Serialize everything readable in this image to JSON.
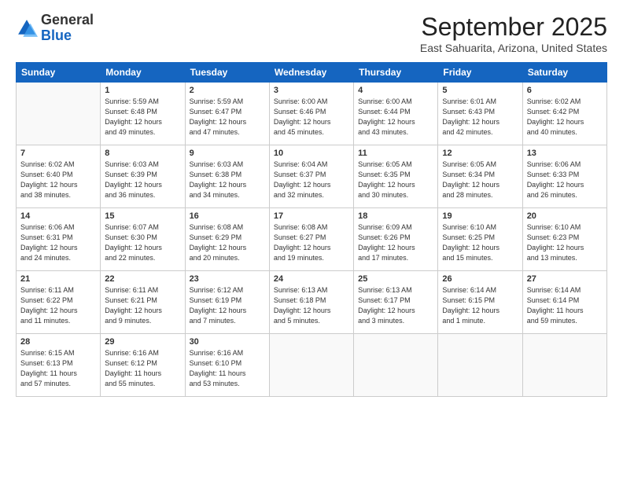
{
  "logo": {
    "general": "General",
    "blue": "Blue"
  },
  "title": "September 2025",
  "location": "East Sahuarita, Arizona, United States",
  "days_of_week": [
    "Sunday",
    "Monday",
    "Tuesday",
    "Wednesday",
    "Thursday",
    "Friday",
    "Saturday"
  ],
  "weeks": [
    [
      {
        "day": "",
        "info": ""
      },
      {
        "day": "1",
        "info": "Sunrise: 5:59 AM\nSunset: 6:48 PM\nDaylight: 12 hours\nand 49 minutes."
      },
      {
        "day": "2",
        "info": "Sunrise: 5:59 AM\nSunset: 6:47 PM\nDaylight: 12 hours\nand 47 minutes."
      },
      {
        "day": "3",
        "info": "Sunrise: 6:00 AM\nSunset: 6:46 PM\nDaylight: 12 hours\nand 45 minutes."
      },
      {
        "day": "4",
        "info": "Sunrise: 6:00 AM\nSunset: 6:44 PM\nDaylight: 12 hours\nand 43 minutes."
      },
      {
        "day": "5",
        "info": "Sunrise: 6:01 AM\nSunset: 6:43 PM\nDaylight: 12 hours\nand 42 minutes."
      },
      {
        "day": "6",
        "info": "Sunrise: 6:02 AM\nSunset: 6:42 PM\nDaylight: 12 hours\nand 40 minutes."
      }
    ],
    [
      {
        "day": "7",
        "info": "Sunrise: 6:02 AM\nSunset: 6:40 PM\nDaylight: 12 hours\nand 38 minutes."
      },
      {
        "day": "8",
        "info": "Sunrise: 6:03 AM\nSunset: 6:39 PM\nDaylight: 12 hours\nand 36 minutes."
      },
      {
        "day": "9",
        "info": "Sunrise: 6:03 AM\nSunset: 6:38 PM\nDaylight: 12 hours\nand 34 minutes."
      },
      {
        "day": "10",
        "info": "Sunrise: 6:04 AM\nSunset: 6:37 PM\nDaylight: 12 hours\nand 32 minutes."
      },
      {
        "day": "11",
        "info": "Sunrise: 6:05 AM\nSunset: 6:35 PM\nDaylight: 12 hours\nand 30 minutes."
      },
      {
        "day": "12",
        "info": "Sunrise: 6:05 AM\nSunset: 6:34 PM\nDaylight: 12 hours\nand 28 minutes."
      },
      {
        "day": "13",
        "info": "Sunrise: 6:06 AM\nSunset: 6:33 PM\nDaylight: 12 hours\nand 26 minutes."
      }
    ],
    [
      {
        "day": "14",
        "info": "Sunrise: 6:06 AM\nSunset: 6:31 PM\nDaylight: 12 hours\nand 24 minutes."
      },
      {
        "day": "15",
        "info": "Sunrise: 6:07 AM\nSunset: 6:30 PM\nDaylight: 12 hours\nand 22 minutes."
      },
      {
        "day": "16",
        "info": "Sunrise: 6:08 AM\nSunset: 6:29 PM\nDaylight: 12 hours\nand 20 minutes."
      },
      {
        "day": "17",
        "info": "Sunrise: 6:08 AM\nSunset: 6:27 PM\nDaylight: 12 hours\nand 19 minutes."
      },
      {
        "day": "18",
        "info": "Sunrise: 6:09 AM\nSunset: 6:26 PM\nDaylight: 12 hours\nand 17 minutes."
      },
      {
        "day": "19",
        "info": "Sunrise: 6:10 AM\nSunset: 6:25 PM\nDaylight: 12 hours\nand 15 minutes."
      },
      {
        "day": "20",
        "info": "Sunrise: 6:10 AM\nSunset: 6:23 PM\nDaylight: 12 hours\nand 13 minutes."
      }
    ],
    [
      {
        "day": "21",
        "info": "Sunrise: 6:11 AM\nSunset: 6:22 PM\nDaylight: 12 hours\nand 11 minutes."
      },
      {
        "day": "22",
        "info": "Sunrise: 6:11 AM\nSunset: 6:21 PM\nDaylight: 12 hours\nand 9 minutes."
      },
      {
        "day": "23",
        "info": "Sunrise: 6:12 AM\nSunset: 6:19 PM\nDaylight: 12 hours\nand 7 minutes."
      },
      {
        "day": "24",
        "info": "Sunrise: 6:13 AM\nSunset: 6:18 PM\nDaylight: 12 hours\nand 5 minutes."
      },
      {
        "day": "25",
        "info": "Sunrise: 6:13 AM\nSunset: 6:17 PM\nDaylight: 12 hours\nand 3 minutes."
      },
      {
        "day": "26",
        "info": "Sunrise: 6:14 AM\nSunset: 6:15 PM\nDaylight: 12 hours\nand 1 minute."
      },
      {
        "day": "27",
        "info": "Sunrise: 6:14 AM\nSunset: 6:14 PM\nDaylight: 11 hours\nand 59 minutes."
      }
    ],
    [
      {
        "day": "28",
        "info": "Sunrise: 6:15 AM\nSunset: 6:13 PM\nDaylight: 11 hours\nand 57 minutes."
      },
      {
        "day": "29",
        "info": "Sunrise: 6:16 AM\nSunset: 6:12 PM\nDaylight: 11 hours\nand 55 minutes."
      },
      {
        "day": "30",
        "info": "Sunrise: 6:16 AM\nSunset: 6:10 PM\nDaylight: 11 hours\nand 53 minutes."
      },
      {
        "day": "",
        "info": ""
      },
      {
        "day": "",
        "info": ""
      },
      {
        "day": "",
        "info": ""
      },
      {
        "day": "",
        "info": ""
      }
    ]
  ]
}
